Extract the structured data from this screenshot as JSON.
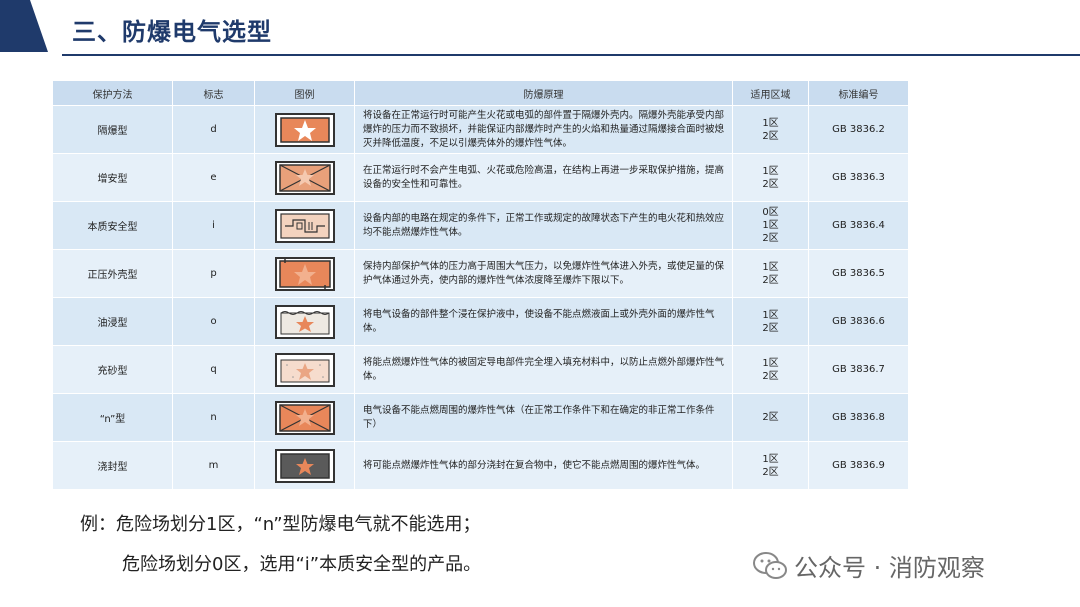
{
  "header": {
    "title": "三、防爆电气选型"
  },
  "table": {
    "headers": [
      "保护方法",
      "标志",
      "图例",
      "防爆原理",
      "适用区域",
      "标准编号"
    ],
    "rows": [
      {
        "method": "隔爆型",
        "mark": "d",
        "icon": "flameproof-icon",
        "principle": "将设备在正常运行时可能产生火花或电弧的部件置于隔爆外壳内。隔爆外壳能承受内部爆炸的压力而不致损坏，并能保证内部爆炸时产生的火焰和热量通过隔爆接合面时被熄灭并降低温度，不足以引爆壳体外的爆炸性气体。",
        "zones": [
          "1区",
          "2区"
        ],
        "standard": "GB 3836.2"
      },
      {
        "method": "增安型",
        "mark": "e",
        "icon": "increased-safety-icon",
        "principle": "在正常运行时不会产生电弧、火花或危险高温，在结构上再进一步采取保护措施，提高设备的安全性和可靠性。",
        "zones": [
          "1区",
          "2区"
        ],
        "standard": "GB 3836.3"
      },
      {
        "method": "本质安全型",
        "mark": "i",
        "icon": "intrinsic-safety-icon",
        "principle": "设备内部的电路在规定的条件下，正常工作或规定的故障状态下产生的电火花和热效应均不能点燃爆炸性气体。",
        "zones": [
          "0区",
          "1区",
          "2区"
        ],
        "standard": "GB 3836.4"
      },
      {
        "method": "正压外壳型",
        "mark": "p",
        "icon": "pressurized-icon",
        "principle": "保持内部保护气体的压力高于周围大气压力，以免爆炸性气体进入外壳，或使足量的保护气体通过外壳，使内部的爆炸性气体浓度降至爆炸下限以下。",
        "zones": [
          "1区",
          "2区"
        ],
        "standard": "GB 3836.5"
      },
      {
        "method": "油浸型",
        "mark": "o",
        "icon": "oil-immersion-icon",
        "principle": "将电气设备的部件整个浸在保护液中，使设备不能点燃液面上或外壳外面的爆炸性气体。",
        "zones": [
          "1区",
          "2区"
        ],
        "standard": "GB 3836.6"
      },
      {
        "method": "充砂型",
        "mark": "q",
        "icon": "sand-filled-icon",
        "principle": "将能点燃爆炸性气体的被固定导电部件完全埋入填充材料中，以防止点燃外部爆炸性气体。",
        "zones": [
          "1区",
          "2区"
        ],
        "standard": "GB 3836.7"
      },
      {
        "method": "“n”型",
        "mark": "n",
        "icon": "type-n-icon",
        "principle": "电气设备不能点燃周围的爆炸性气体（在正常工作条件下和在确定的非正常工作条件下）",
        "zones": [
          "2区"
        ],
        "standard": "GB 3836.8"
      },
      {
        "method": "浇封型",
        "mark": "m",
        "icon": "encapsulation-icon",
        "principle": "将可能点燃爆炸性气体的部分浇封在复合物中，使它不能点燃周围的爆炸性气体。",
        "zones": [
          "1区",
          "2区"
        ],
        "standard": "GB 3836.9"
      }
    ]
  },
  "notes": {
    "line1": "例：危险场划分1区，“n”型防爆电气就不能选用；",
    "line2": "危险场划分0区，选用“i”本质安全型的产品。"
  },
  "watermark": {
    "icon": "wechat-icon",
    "text": "公众号 · 消防观察"
  },
  "colors": {
    "accent": "#1f3a6b",
    "header_bg": "#c9dcef",
    "row_bg": "#d9e8f5",
    "icon_fill": "#e8875a"
  }
}
